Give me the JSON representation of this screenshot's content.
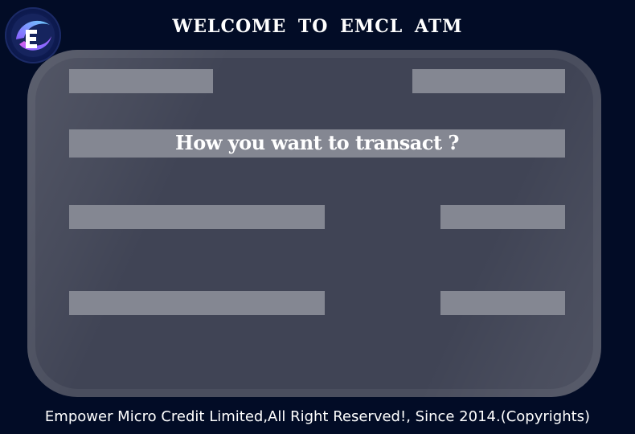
{
  "header": {
    "title": "WELCOME TO EMCL ATM",
    "logo_icon": "emcl-logo-icon"
  },
  "card": {
    "prompt": "How you want to transact ?",
    "buttons": [
      {
        "id": "top-left",
        "label": ""
      },
      {
        "id": "top-right",
        "label": ""
      },
      {
        "id": "mid-left",
        "label": ""
      },
      {
        "id": "mid-right",
        "label": ""
      },
      {
        "id": "bottom-left",
        "label": ""
      },
      {
        "id": "bottom-right",
        "label": ""
      }
    ]
  },
  "footer": {
    "text": "Empower Micro Credit Limited,All Right Reserved!, Since 2014.(Copyrights)"
  },
  "colors": {
    "background": "#020c26",
    "card": "#404455",
    "card_border": "#4a4e5e",
    "button": "#848792",
    "text": "#ffffff"
  }
}
